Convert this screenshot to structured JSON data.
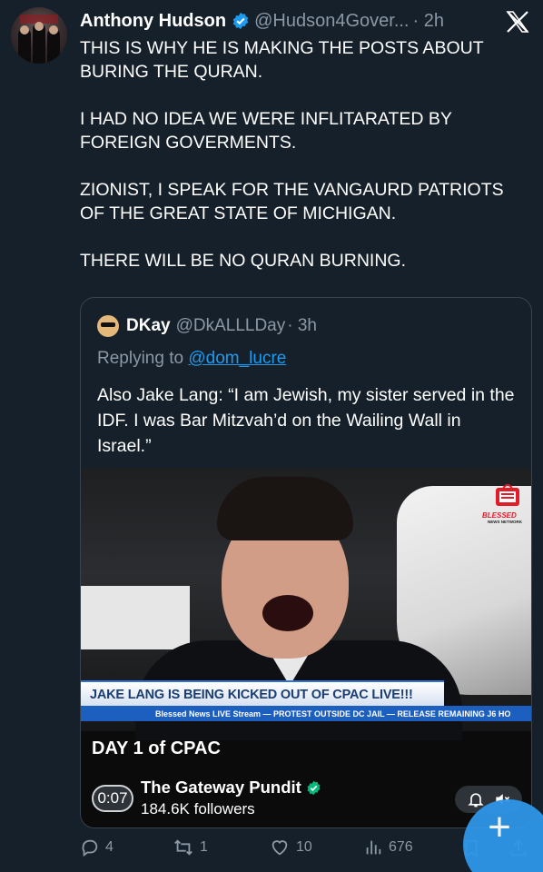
{
  "post": {
    "author_name": "Anthony Hudson",
    "handle": "@Hudson4Gover...",
    "time": "· 2h",
    "paragraphs": [
      "THIS IS WHY HE IS MAKING THE POSTS ABOUT BURING THE QURAN.",
      "I HAD NO IDEA WE WERE INFLITARATED BY FOREIGN GOVERMENTS.",
      "ZIONIST, I SPEAK FOR THE VANGAURD PATRIOTS OF THE GREAT STATE OF MICHIGAN.",
      "THERE WILL BE NO QURAN BURNING."
    ]
  },
  "quote": {
    "author_name": "DKay",
    "handle": "@DkALLLDay",
    "time": "· 3h",
    "replying_prefix": "Replying to ",
    "replying_to": "@dom_lucre",
    "text": "Also Jake Lang: “I am Jewish, my sister served in the IDF. I was Bar Mitzvah’d on the Wailing Wall in Israel.”"
  },
  "video": {
    "logo_text": "BLESSED",
    "logo_sub": "NEWS NETWORK",
    "lower_third": "JAKE LANG IS BEING KICKED OUT OF CPAC LIVE!!!",
    "ticker": "Blessed News LIVE Stream — PROTEST OUTSIDE DC JAIL — RELEASE REMAINING J6 HO",
    "title": "DAY 1 of CPAC",
    "timestamp": "0:07",
    "channel_name": "The Gateway Pundit",
    "followers": "184.6K followers"
  },
  "actions": {
    "replies": "4",
    "reposts": "1",
    "likes": "10",
    "views": "676"
  },
  "colors": {
    "background": "#15202b",
    "accent": "#1d9bf0",
    "muted": "#8b98a5",
    "verified_gold": "#1d9bf0",
    "verified_green": "#00ba7c"
  },
  "icons": [
    "verified-icon",
    "close-x-icon",
    "reply-icon",
    "repost-icon",
    "like-icon",
    "views-icon",
    "bookmark-icon",
    "share-icon",
    "bell-icon",
    "mute-icon",
    "plus-icon"
  ]
}
